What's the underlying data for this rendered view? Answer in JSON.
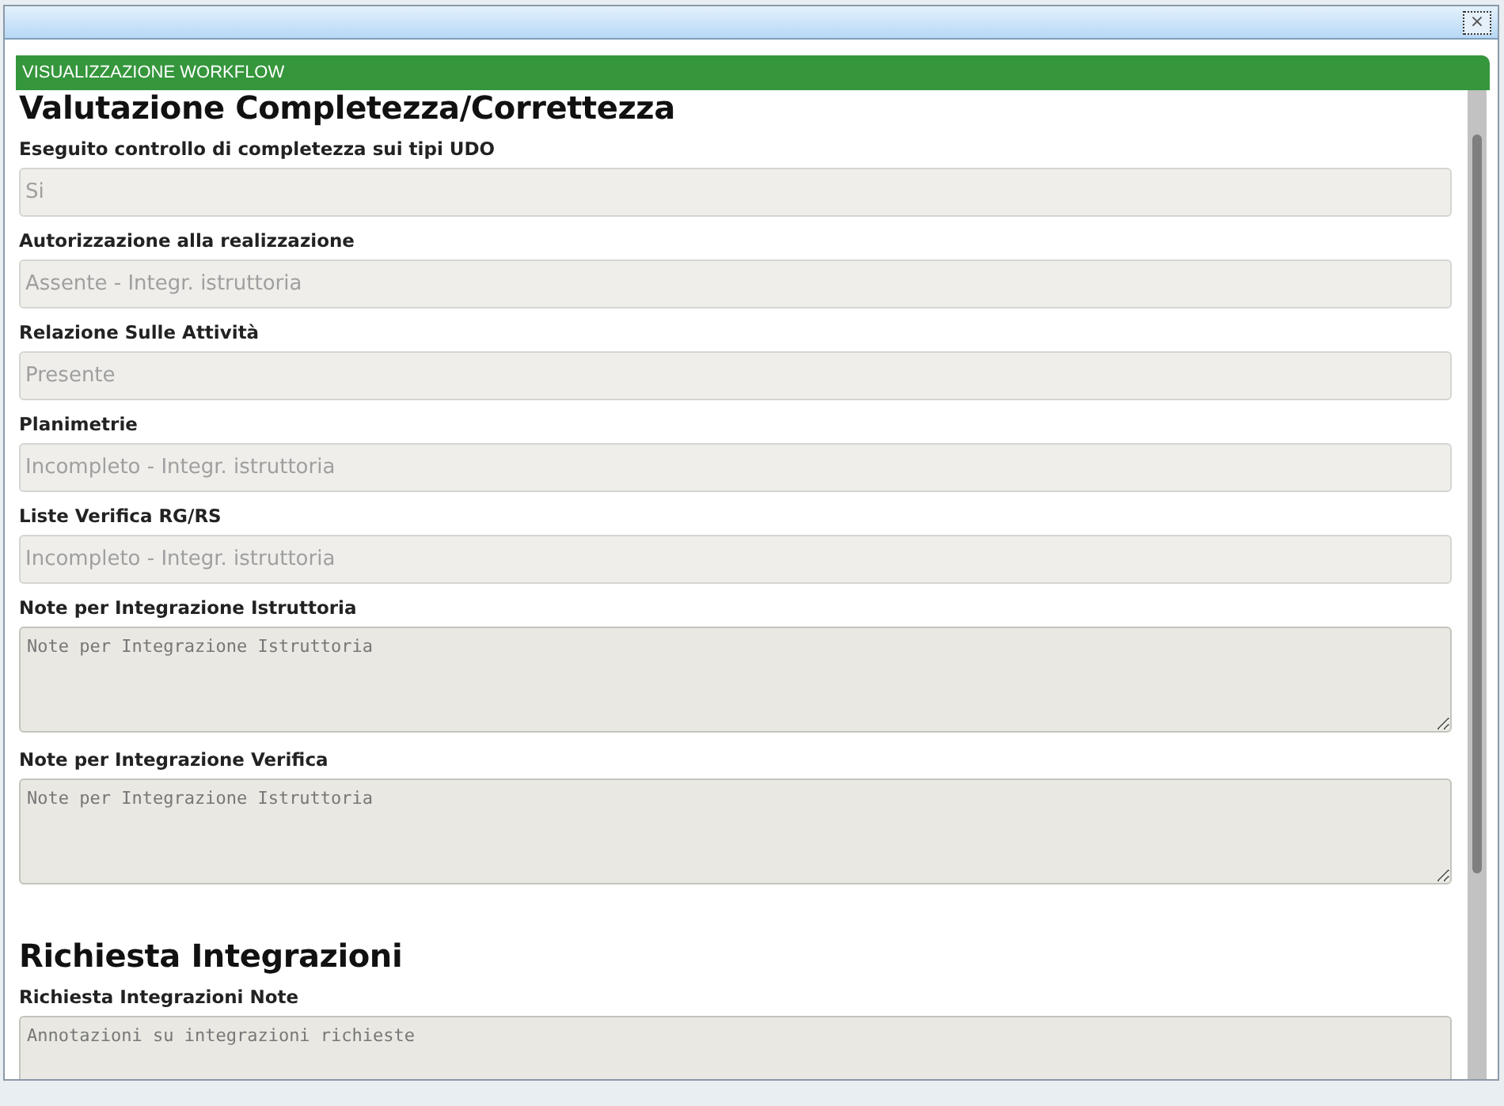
{
  "dialog": {
    "close": "×",
    "header": "VISUALIZZAZIONE WORKFLOW"
  },
  "sections": [
    {
      "title": "Valutazione Completezza/Correttezza",
      "fields": [
        {
          "kind": "select",
          "label": "Eseguito controllo di completezza sui tipi UDO",
          "value": "Si",
          "disabled": true
        },
        {
          "kind": "select",
          "label": "Autorizzazione alla realizzazione",
          "value": "Assente - Integr. istruttoria",
          "disabled": true
        },
        {
          "kind": "select",
          "label": "Relazione Sulle Attività",
          "value": "Presente",
          "disabled": true
        },
        {
          "kind": "select",
          "label": "Planimetrie",
          "value": "Incompleto - Integr. istruttoria",
          "disabled": true
        },
        {
          "kind": "select",
          "label": "Liste Verifica RG/RS",
          "value": "Incompleto - Integr. istruttoria",
          "disabled": true
        },
        {
          "kind": "textarea",
          "label": "Note per Integrazione Istruttoria",
          "placeholder": "Note per Integrazione Istruttoria",
          "disabled": true
        },
        {
          "kind": "textarea",
          "label": "Note per Integrazione Verifica",
          "placeholder": "Note per Integrazione Istruttoria",
          "disabled": true
        }
      ]
    },
    {
      "title": "Richiesta Integrazioni",
      "fields": [
        {
          "kind": "textarea",
          "label": "Richiesta Integrazioni Note",
          "placeholder": "Annotazioni su integrazioni richieste",
          "disabled": true
        }
      ]
    }
  ]
}
